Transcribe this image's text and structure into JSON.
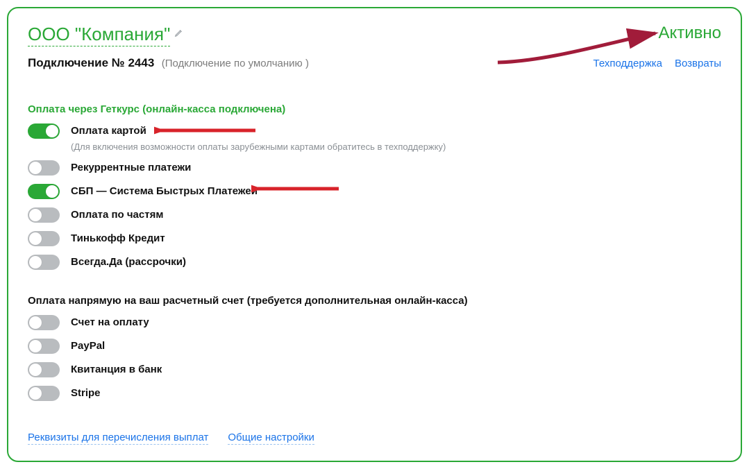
{
  "colors": {
    "accent": "#2aa836",
    "link": "#1a73e8"
  },
  "header": {
    "company_name": "ООО \"Компания\"",
    "status": "Активно"
  },
  "subheader": {
    "connection_title": "Подключение № 2443",
    "connection_note": "(Подключение по умолчанию )",
    "links": {
      "support": "Техподдержка",
      "refunds": "Возвраты"
    }
  },
  "section_getcourse": {
    "title": "Оплата через Геткурс (онлайн-касса подключена)",
    "items": [
      {
        "label": "Оплата картой",
        "enabled": true,
        "sub": "(Для включения возможности оплаты зарубежными картами обратитесь в техподдержку)"
      },
      {
        "label": "Рекуррентные платежи",
        "enabled": false
      },
      {
        "label": "СБП — Система Быстрых Платежей",
        "enabled": true
      },
      {
        "label": "Оплата по частям",
        "enabled": false
      },
      {
        "label": "Тинькофф Кредит",
        "enabled": false
      },
      {
        "label": "Всегда.Да (рассрочки)",
        "enabled": false
      }
    ]
  },
  "section_direct": {
    "title": "Оплата напрямую на ваш расчетный счет (требуется дополнительная онлайн-касса)",
    "items": [
      {
        "label": "Счет на оплату",
        "enabled": false
      },
      {
        "label": "PayPal",
        "enabled": false
      },
      {
        "label": "Квитанция в банк",
        "enabled": false
      },
      {
        "label": "Stripe",
        "enabled": false
      }
    ]
  },
  "footer": {
    "payout_details": "Реквизиты для перечисления выплат",
    "general_settings": "Общие настройки"
  }
}
